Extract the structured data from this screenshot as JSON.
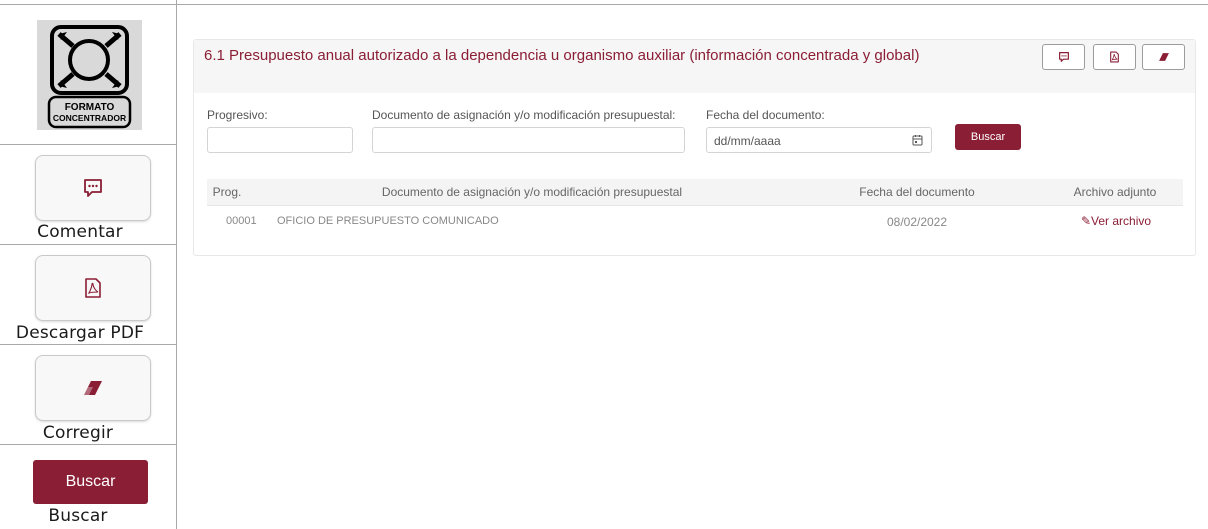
{
  "legend": {
    "logo_line1": "FORMATO",
    "logo_line2": "CONCENTRADOR",
    "items": [
      {
        "label": "Comentar",
        "icon": "comment-icon"
      },
      {
        "label": "Descargar PDF",
        "icon": "pdf-icon"
      },
      {
        "label": "Corregir",
        "icon": "eraser-icon"
      },
      {
        "label": "Buscar",
        "button_label": "Buscar"
      }
    ]
  },
  "card": {
    "title": "6.1 Presupuesto anual autorizado a la dependencia u organismo auxiliar (información concentrada y global)",
    "actions": [
      {
        "icon": "comment-icon"
      },
      {
        "icon": "pdf-icon"
      },
      {
        "icon": "eraser-icon"
      }
    ]
  },
  "filters": {
    "progresivo_label": "Progresivo:",
    "progresivo_value": "",
    "documento_label": "Documento de asignación y/o modificación presupuestal:",
    "documento_value": "",
    "fecha_label": "Fecha del documento:",
    "fecha_placeholder": "dd/mm/aaaa",
    "search_button": "Buscar"
  },
  "table": {
    "headers": [
      "Prog.",
      "Documento de asignación y/o modificación presupuestal",
      "Fecha del documento",
      "Archivo adjunto"
    ],
    "rows": [
      {
        "prog": "00001",
        "documento": "OFICIO DE PRESUPUESTO COMUNICADO",
        "fecha": "08/02/2022",
        "archivo": "✎Ver archivo"
      }
    ]
  },
  "colors": {
    "accent": "#8a1e35",
    "legend_border": "#a8a8a8"
  }
}
